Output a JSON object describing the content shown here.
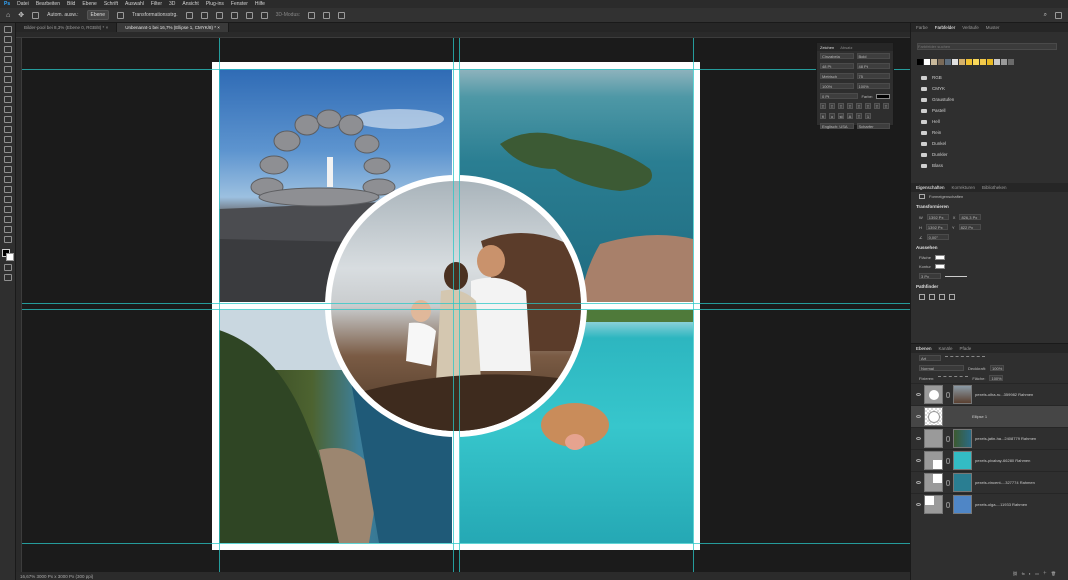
{
  "menu": [
    "Ps",
    "Datei",
    "Bearbeiten",
    "Bild",
    "Ebene",
    "Schrift",
    "Auswahl",
    "Filter",
    "3D",
    "Ansicht",
    "Plug-ins",
    "Fenster",
    "Hilfe"
  ],
  "options": {
    "auto_select": "Autom. ausw.:",
    "target": "Ebene",
    "transform": "Transformationsstrg.",
    "mode_3d": "3D-Modus:"
  },
  "doc_tabs": [
    {
      "label": "Bilder-pool bei 8,3% (Ebene 0, RGB/8) *",
      "active": false
    },
    {
      "label": "Unbenannt-1 bei 16,7% (Ellipse 1, CMYK/8) *",
      "active": true
    }
  ],
  "status": "16,67%    3000 Px x 3000 Px (300 ppi)",
  "char_panel": {
    "tabs": [
      "Zeichen",
      "Absatz"
    ],
    "font": "Cinzabela",
    "style": "Bold",
    "size": "48 Pt",
    "leading": "48 Pt",
    "kerning": "Metrisch",
    "tracking": "75",
    "scale_v": "100%",
    "scale_h": "100%",
    "baseline": "0 Pt",
    "color_label": "Farbe:",
    "language": "Englisch: USA",
    "aa": "Scharfer"
  },
  "swatches": {
    "tabs": [
      "Farbe",
      "Farbfelder",
      "Verläufe",
      "Muster"
    ],
    "search_placeholder": "Farbfelder suchen",
    "colors": [
      "#000000",
      "#ffffff",
      "#c8b89a",
      "#7a6a58",
      "#5e6e7e",
      "#e0e0e0",
      "#d4b06a",
      "#f1c232",
      "#f9d85a",
      "#f2c94c",
      "#e8b923",
      "#c9c9c9",
      "#9a9a9a",
      "#6b6b6b"
    ],
    "folders": [
      "RGB",
      "CMYK",
      "Graustufen",
      "Pastell",
      "Hell",
      "Rein",
      "Dunkel",
      "Dunkler",
      "Blass"
    ]
  },
  "properties": {
    "tabs": [
      "Eigenschaften",
      "Korrekturen",
      "Bibliotheken"
    ],
    "kind": "Formeigenschaften",
    "transform_title": "Transformieren",
    "w": "1392 Px",
    "x": "826,3 Px",
    "h": "1392 Px",
    "y": "822 Px",
    "angle": "0,00°",
    "appearance_title": "Aussehen",
    "fill_label": "Fläche",
    "stroke_label": "Kontur",
    "stroke_w": "3 Px",
    "pathfinder_title": "Pathfinder"
  },
  "layers_panel": {
    "tabs": [
      "Ebenen",
      "Kanäle",
      "Pfade"
    ],
    "kind": "Art",
    "blend": "Normal",
    "opacity_label": "Deckkraft:",
    "opacity": "100%",
    "lock_label": "Fixieren:",
    "fill_label": "Fläche:",
    "fill": "100%",
    "layers": [
      {
        "name": "pexels-olha-ru...359982 Rahmen",
        "selected": false
      },
      {
        "name": "Ellipse 1",
        "selected": true
      },
      {
        "name": "pexels-jatin-ha...2408779 Rahmen",
        "selected": false
      },
      {
        "name": "pexels-pixabay-66280 Rahmen",
        "selected": false
      },
      {
        "name": "pexels-vincent-...327774 Rahmen",
        "selected": false
      },
      {
        "name": "pexels-olga-...11933 Rahmen",
        "selected": false
      }
    ]
  }
}
